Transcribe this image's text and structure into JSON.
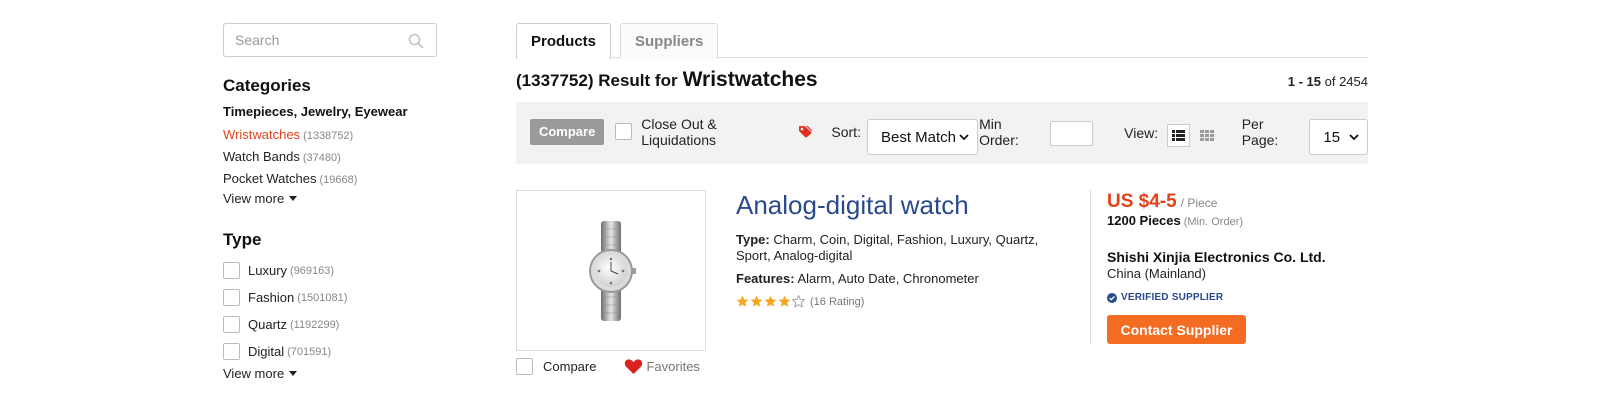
{
  "search": {
    "placeholder": "Search"
  },
  "categories": {
    "heading": "Categories",
    "parent": "Timepieces, Jewelry, Eyewear",
    "items": [
      {
        "name": "Wristwatches",
        "count": "(1338752)",
        "active": true
      },
      {
        "name": "Watch Bands",
        "count": "(37480)"
      },
      {
        "name": "Pocket Watches",
        "count": "(19668)"
      }
    ],
    "view_more": "View more"
  },
  "type_filter": {
    "heading": "Type",
    "items": [
      {
        "name": "Luxury",
        "count": "(969163)"
      },
      {
        "name": "Fashion",
        "count": "(1501081)"
      },
      {
        "name": "Quartz",
        "count": "(1192299)"
      },
      {
        "name": "Digital",
        "count": "(701591)"
      }
    ],
    "view_more": "View more"
  },
  "tabs": [
    {
      "label": "Products",
      "active": true
    },
    {
      "label": "Suppliers",
      "active": false
    }
  ],
  "results": {
    "prefix": "(1337752) Result for",
    "keyword": "Wristwatches",
    "range": "1 - 15",
    "of_text": "of",
    "total": "2454"
  },
  "toolbar": {
    "compare_label": "Compare",
    "closeout_label": "Close Out & Liquidations",
    "sort_label": "Sort:",
    "sort_value": "Best Match",
    "min_order_label": "Min Order:",
    "view_label": "View:",
    "per_page_label": "Per Page:",
    "per_page_value": "15"
  },
  "product": {
    "title": "Analog-digital watch",
    "type_label": "Type:",
    "type_value": "Charm, Coin, Digital, Fashion, Luxury, Quartz, Sport, Analog-digital",
    "features_label": "Features:",
    "features_value": "Alarm, Auto Date, Chronometer",
    "rating_stars": 4,
    "rating_max": 5,
    "rating_text": "(16 Rating)",
    "compare_label": "Compare",
    "favorites_label": "Favorites",
    "price": "US $4-5",
    "price_unit": "/ Piece",
    "min_order": "1200 Pieces",
    "min_order_suffix": "(Min. Order)",
    "supplier_name": "Shishi Xinjia Electronics Co. Ltd.",
    "supplier_location": "China (Mainland)",
    "verified_label": "VERIFIED SUPPLIER",
    "contact_label": "Contact Supplier"
  },
  "colors": {
    "accent_orange": "#f46b22",
    "price_red": "#e3411a",
    "title_blue": "#2b4a8c",
    "active_category": "#e0431f",
    "star": "#f5a623"
  },
  "icons": [
    "search-icon",
    "tag-icon",
    "chevron-down-icon",
    "list-view-icon",
    "grid-view-icon",
    "heart-icon",
    "check-circle-icon",
    "star-icon",
    "caret-down-icon"
  ]
}
